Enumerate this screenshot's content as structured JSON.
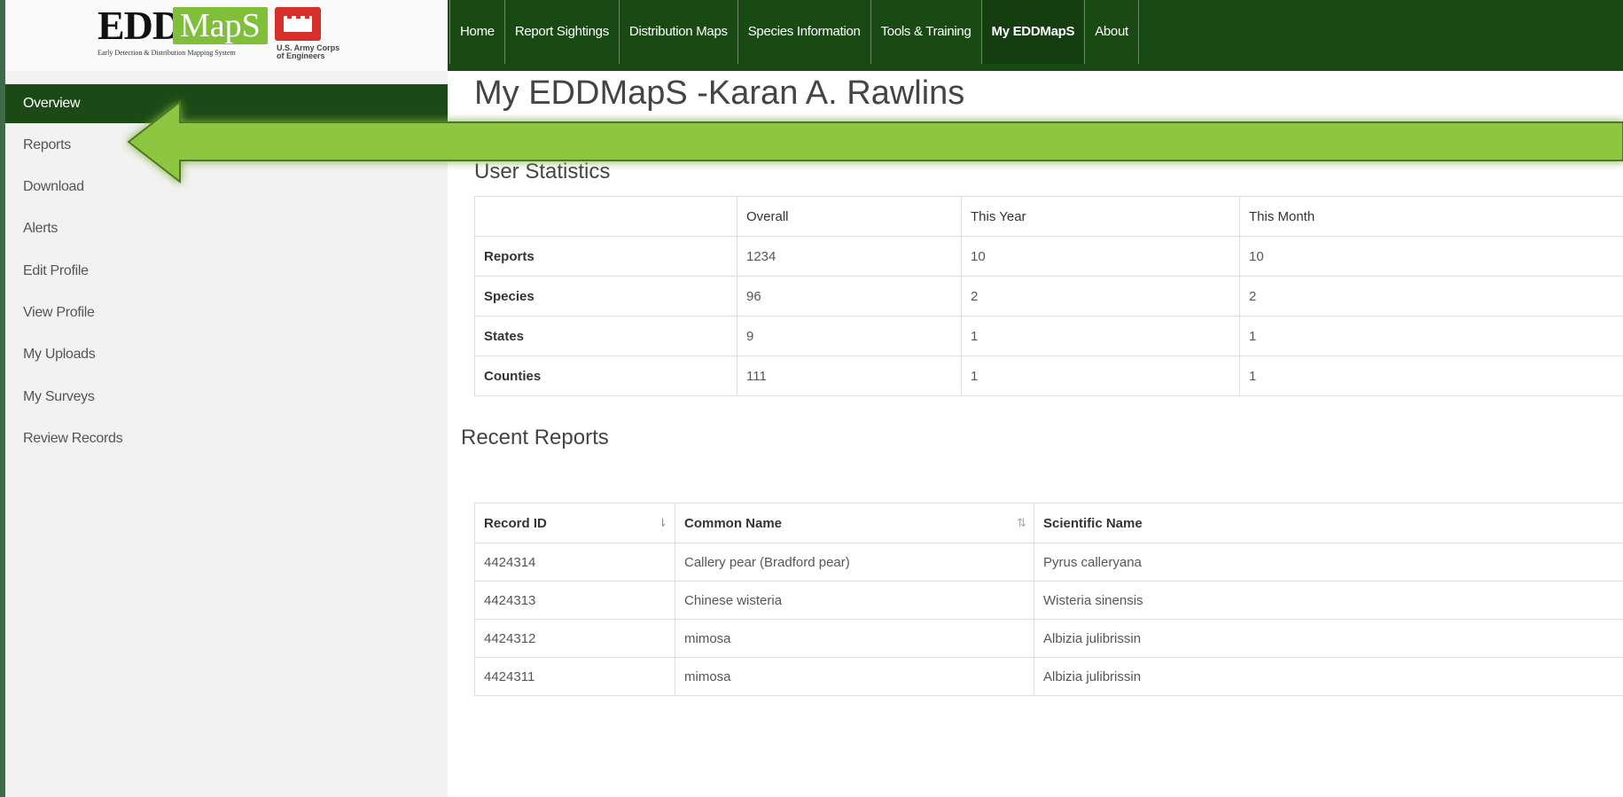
{
  "logo": {
    "edd": "EDD",
    "maps": "MapS",
    "tagline": "Early Detection & Distribution Mapping System",
    "usace_line1": "U.S. Army Corps",
    "usace_line2": "of Engineers"
  },
  "nav": {
    "items": [
      "Home",
      "Report Sightings",
      "Distribution Maps",
      "Species Information",
      "Tools & Training",
      "My EDDMapS",
      "About"
    ],
    "active": "My EDDMapS"
  },
  "sidebar": {
    "items": [
      "Overview",
      "Reports",
      "Download",
      "Alerts",
      "Edit Profile",
      "View Profile",
      "My Uploads",
      "My Surveys",
      "Review Records"
    ],
    "active": "Overview"
  },
  "page": {
    "title": "My EDDMapS -Karan A. Rawlins"
  },
  "stats": {
    "title": "User Statistics",
    "headers": [
      "",
      "Overall",
      "This Year",
      "This Month"
    ],
    "rows": [
      {
        "label": "Reports",
        "overall": "1234",
        "year": "10",
        "month": "10"
      },
      {
        "label": "Species",
        "overall": "96",
        "year": "2",
        "month": "2"
      },
      {
        "label": "States",
        "overall": "9",
        "year": "1",
        "month": "1"
      },
      {
        "label": "Counties",
        "overall": "111",
        "year": "1",
        "month": "1"
      }
    ]
  },
  "recent": {
    "title": "Recent Reports",
    "headers": [
      "Record ID",
      "Common Name",
      "Scientific Name"
    ],
    "rows": [
      {
        "id": "4424314",
        "common": "Callery pear (Bradford pear)",
        "scientific": "Pyrus calleryana"
      },
      {
        "id": "4424313",
        "common": "Chinese wisteria",
        "scientific": "Wisteria sinensis"
      },
      {
        "id": "4424312",
        "common": "mimosa",
        "scientific": "Albizia julibrissin"
      },
      {
        "id": "4424311",
        "common": "mimosa",
        "scientific": "Albizia julibrissin"
      }
    ]
  },
  "colors": {
    "nav_bg": "#1a4a14",
    "accent_green": "#7fbf3a",
    "arrow_fill": "#8dc63f",
    "usace_red": "#d6302a"
  }
}
